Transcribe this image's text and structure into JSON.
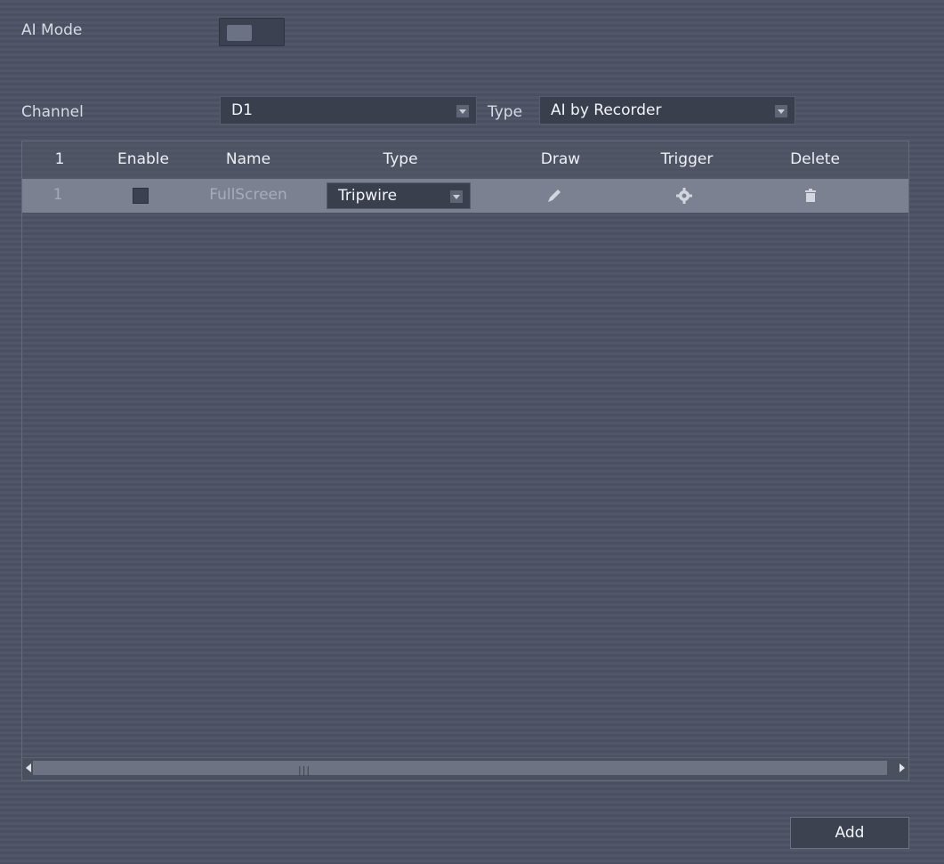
{
  "ai_mode": {
    "label": "AI Mode",
    "enabled": false
  },
  "channel": {
    "label": "Channel",
    "value": "D1"
  },
  "type_filter": {
    "label": "Type",
    "value": "AI by Recorder"
  },
  "table": {
    "headers": {
      "index": "1",
      "enable": "Enable",
      "name": "Name",
      "type": "Type",
      "draw": "Draw",
      "trigger": "Trigger",
      "delete": "Delete"
    },
    "rows": [
      {
        "index": "1",
        "enabled": false,
        "name": "FullScreen",
        "type": "Tripwire",
        "draw_icon": "pencil-icon",
        "trigger_icon": "gear-icon",
        "delete_icon": "trash-icon"
      }
    ]
  },
  "scrollbar": {
    "grip": "|||"
  },
  "add_button": {
    "label": "Add"
  },
  "colors": {
    "background": "#4c5364",
    "row_highlight": "#7c8192",
    "text": "#e4e7ee"
  }
}
